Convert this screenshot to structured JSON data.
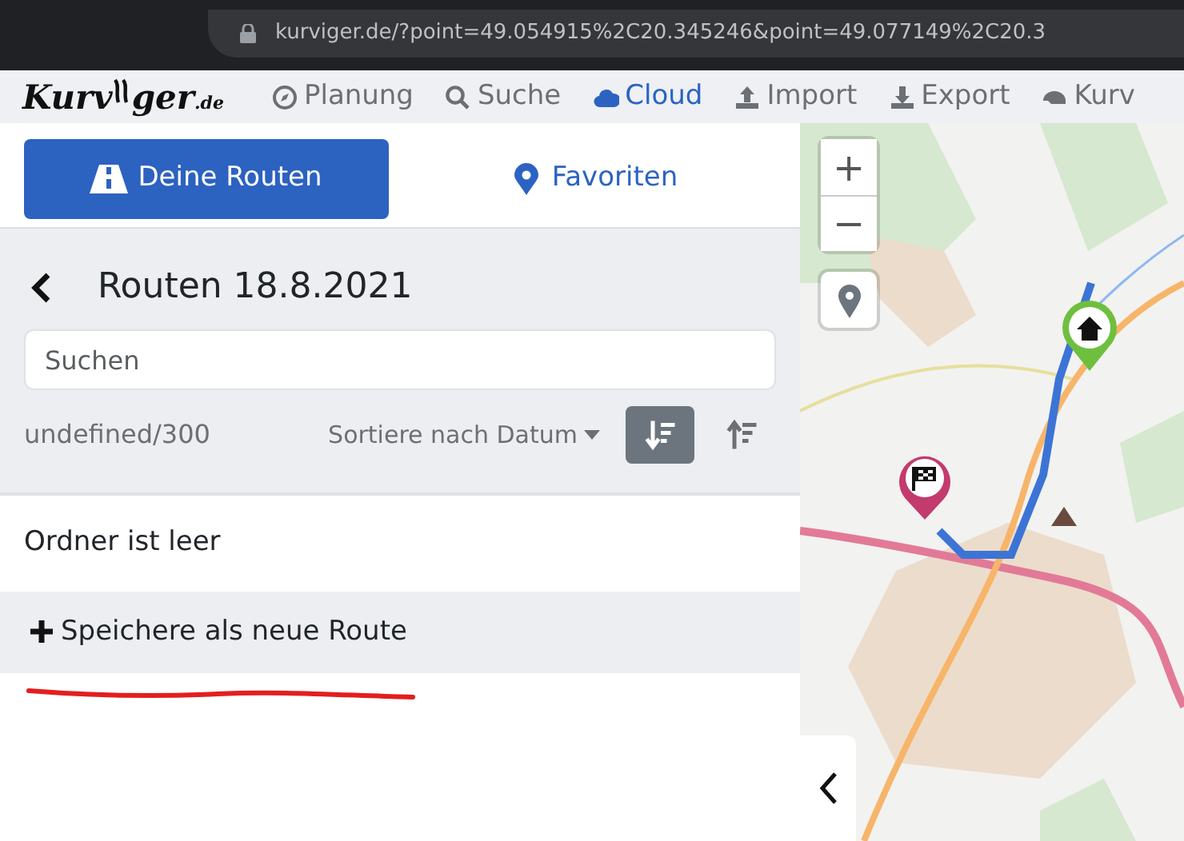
{
  "browser": {
    "url": "kurviger.de/?point=49.054915%2C20.345246&point=49.077149%2C20.3"
  },
  "logo": {
    "before": "Kurv",
    "after": "ger",
    "suffix": ".de"
  },
  "nav": [
    {
      "kind": "compass",
      "label": "Planung",
      "selected": false
    },
    {
      "kind": "search",
      "label": "Suche",
      "selected": false
    },
    {
      "kind": "cloud",
      "label": "Cloud",
      "selected": true
    },
    {
      "kind": "upload",
      "label": "Import",
      "selected": false
    },
    {
      "kind": "download",
      "label": "Export",
      "selected": false
    },
    {
      "kind": "helmet",
      "label": "Kurv",
      "selected": false
    }
  ],
  "tabs": [
    {
      "kind": "road",
      "label": "Deine Routen",
      "selected": true
    },
    {
      "kind": "pin",
      "label": "Favoriten",
      "selected": false
    }
  ],
  "folder": {
    "title": "Routen 18.8.2021",
    "search": {
      "placeholder": "Suchen"
    },
    "count": "undefined/300",
    "sort_label": "Sortiere nach Datum",
    "sort_buttons": [
      {
        "kind": "desc",
        "selected": true
      },
      {
        "kind": "asc",
        "selected": false
      }
    ]
  },
  "empty_message": "Ordner ist leer",
  "save_action": {
    "label": "Speichere als neue Route"
  },
  "annotation": {
    "kind": "underline",
    "color": "#e41e1e"
  },
  "map": {
    "kind": "picture",
    "controls": [
      "+",
      "−"
    ]
  }
}
